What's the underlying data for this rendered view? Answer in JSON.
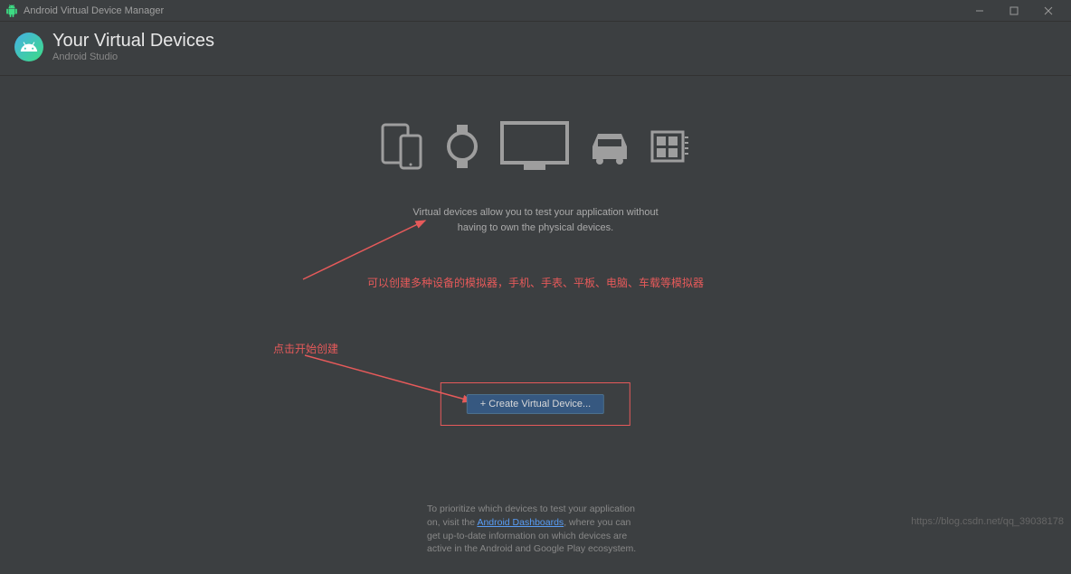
{
  "window": {
    "title": "Android Virtual Device Manager"
  },
  "header": {
    "title": "Your Virtual Devices",
    "subtitle": "Android Studio",
    "icon_label": "A"
  },
  "annotations": {
    "devices_hint": "可以创建多种设备的模拟器，手机、手表、平板、电脑、车载等模拟器",
    "click_hint": "点击开始创建"
  },
  "description": {
    "line1": "Virtual devices allow you to test your application without",
    "line2": "having to own the physical devices."
  },
  "button": {
    "create_label": "+  Create Virtual Device..."
  },
  "footer": {
    "part1": "To prioritize which devices to test your application on, visit the ",
    "link_text": "Android Dashboards",
    "part2": ", where you can get up-to-date information on which devices are active in the Android and Google Play ecosystem."
  },
  "watermark": "https://blog.csdn.net/qq_39038178"
}
